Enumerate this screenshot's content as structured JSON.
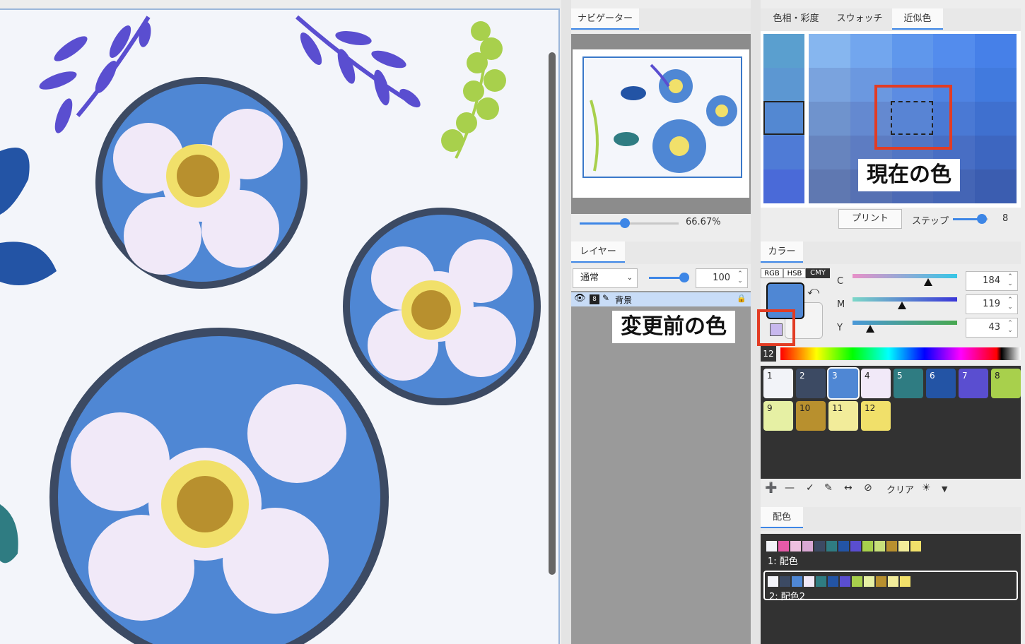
{
  "navigator": {
    "tab": "ナビゲーター",
    "zoom": "66.67%",
    "zoom_fraction": 0.46
  },
  "layer": {
    "tab": "レイヤー",
    "blend_mode": "通常",
    "opacity": "100",
    "opacity_fraction": 0.9,
    "row_name": "背景",
    "row_number": "8"
  },
  "similar": {
    "tabs": [
      "色相・彩度",
      "スウォッチ",
      "近似色"
    ],
    "active_tab": "近似色",
    "print_label": "プリント",
    "step_label": "ステップ",
    "step_value": "8",
    "step_fraction": 0.82
  },
  "color": {
    "tab": "カラー",
    "modes": [
      "RGB",
      "HSB",
      "CMY"
    ],
    "active_mode": "CMY",
    "channels": [
      {
        "label": "C",
        "value": "184",
        "fraction": 0.72
      },
      {
        "label": "M",
        "value": "119",
        "fraction": 0.47
      },
      {
        "label": "Y",
        "value": "43",
        "fraction": 0.17
      }
    ],
    "current_color": "#4f87d4",
    "previous_color": "#c8b8ee",
    "spectrum_label": "12"
  },
  "swatches": [
    {
      "n": "1",
      "color": "#f2f3f8"
    },
    {
      "n": "2",
      "color": "#3c4a63"
    },
    {
      "n": "3",
      "color": "#4f87d4"
    },
    {
      "n": "4",
      "color": "#f1e9f8"
    },
    {
      "n": "5",
      "color": "#2f7c82"
    },
    {
      "n": "6",
      "color": "#2354a5"
    },
    {
      "n": "7",
      "color": "#5a4ed0"
    },
    {
      "n": "8",
      "color": "#a8d04c"
    },
    {
      "n": "9",
      "color": "#e6f0a4"
    },
    {
      "n": "10",
      "color": "#b8902e"
    },
    {
      "n": "11",
      "color": "#f2ec9a"
    },
    {
      "n": "12",
      "color": "#f1e06a"
    }
  ],
  "swatch_tools": {
    "clear_label": "クリア"
  },
  "haishoku": {
    "tab": "配色",
    "sets": [
      {
        "label": "1: 配色",
        "colors": [
          "#f2f3f8",
          "#e45aa8",
          "#eec0e0",
          "#d9a8d4",
          "#3c4a63",
          "#2f7c82",
          "#2354a5",
          "#5a4ed0",
          "#a8d04c",
          "#c8e07a",
          "#b8902e",
          "#f2ec9a",
          "#f1e06a"
        ]
      },
      {
        "label": "2: 配色2",
        "colors": [
          "#f2f3f8",
          "#3c4a63",
          "#4f87d4",
          "#f1e9f8",
          "#2f7c82",
          "#2354a5",
          "#5a4ed0",
          "#a8d04c",
          "#e6f0a4",
          "#b8902e",
          "#f2ec9a",
          "#f1e06a"
        ]
      }
    ]
  },
  "callouts": {
    "current": "現在の色",
    "previous": "変更前の色"
  }
}
